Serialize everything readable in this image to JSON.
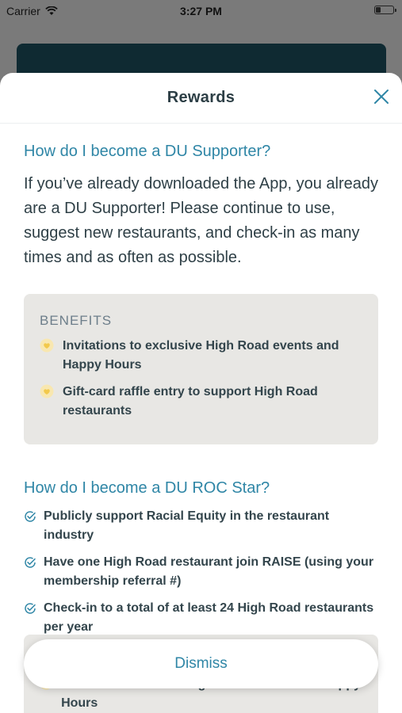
{
  "status_bar": {
    "carrier": "Carrier",
    "time": "3:27 PM"
  },
  "sheet": {
    "title": "Rewards"
  },
  "supporter": {
    "question": "How do I become a DU Supporter?",
    "answer": "If you’ve already downloaded the App, you already are a DU Supporter! Please continue to use, suggest new restaurants, and check-in as many times and as often as possible."
  },
  "benefits": {
    "heading": "BENEFITS",
    "items": [
      "Invitations to exclusive High Road events and Happy Hours",
      "Gift-card raffle entry to support High Road restaurants"
    ]
  },
  "roc_star": {
    "question": "How do I become a DU ROC Star?",
    "requirements": [
      "Publicly support Racial Equity in the restaurant industry",
      "Have one High Road restaurant join RAISE (using your membership referral #)",
      "Check-in to a total of at least 24 High Road restaurants per year"
    ],
    "benefit_partial": "Access to exclusive High Road events and Happy Hours"
  },
  "dismiss_label": "Dismiss",
  "colors": {
    "accent": "#2f86a6",
    "heart": "#f2c94c",
    "box": "#e8e7e4"
  },
  "icons": {
    "close": "close-icon",
    "benefit": "heart-icon",
    "requirement": "check-circle-icon"
  }
}
